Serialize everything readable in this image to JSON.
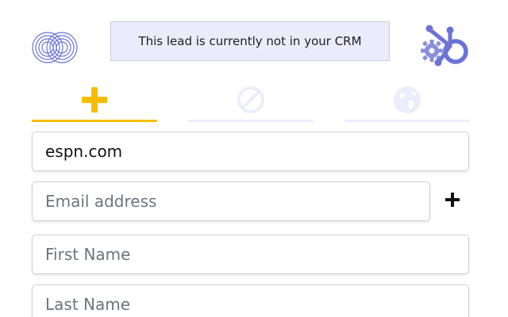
{
  "header": {
    "banner_text": "This lead is currently not in your CRM",
    "logo_icon": "concentric-rings-logo",
    "crm_icon": "hubspot-gear-icon"
  },
  "tabs": [
    {
      "name": "add",
      "icon": "plus-icon",
      "active": true
    },
    {
      "name": "block",
      "icon": "prohibited-icon",
      "active": false
    },
    {
      "name": "web",
      "icon": "globe-icon",
      "active": false
    }
  ],
  "form": {
    "domain_value": "espn.com",
    "email_placeholder": "Email address",
    "first_name_placeholder": "First Name",
    "last_name_placeholder": "Last Name",
    "add_email_icon": "plus-icon"
  },
  "colors": {
    "accent": "#f6bd00",
    "brand": "#6b73d6",
    "banner_bg": "#ebebfb",
    "inactive_tab": "#ececfb"
  }
}
